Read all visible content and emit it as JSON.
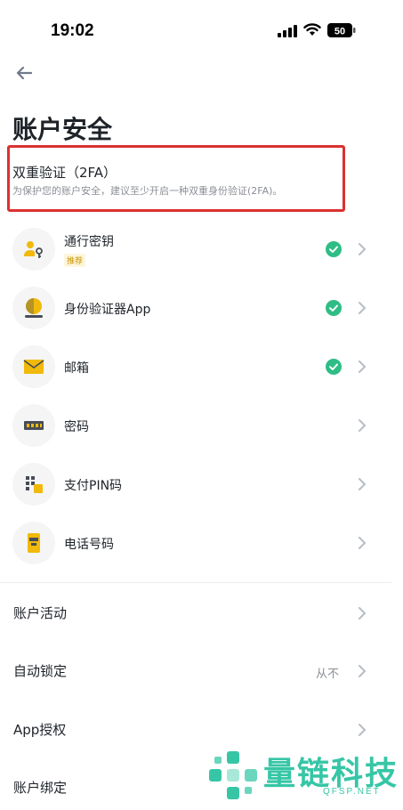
{
  "status_bar": {
    "time": "19:02",
    "battery": "50"
  },
  "page": {
    "title": "账户安全"
  },
  "two_fa": {
    "title": "双重验证（2FA）",
    "description": "为保护您的账户安全，建议至少开启一种双重身份验证(2FA)。"
  },
  "methods": [
    {
      "label": "通行密钥",
      "badge": "推荐",
      "enabled": true,
      "icon": "passkey-icon"
    },
    {
      "label": "身份验证器App",
      "enabled": true,
      "icon": "authenticator-icon"
    },
    {
      "label": "邮箱",
      "enabled": true,
      "icon": "email-icon"
    },
    {
      "label": "密码",
      "enabled": false,
      "icon": "password-icon"
    },
    {
      "label": "支付PIN码",
      "enabled": false,
      "icon": "pin-icon"
    },
    {
      "label": "电话号码",
      "enabled": false,
      "icon": "phone-icon"
    }
  ],
  "settings": [
    {
      "label": "账户活动",
      "value": ""
    },
    {
      "label": "自动锁定",
      "value": "从不"
    },
    {
      "label": "App授权",
      "value": ""
    },
    {
      "label": "账户绑定",
      "value": ""
    }
  ],
  "watermark": {
    "text": "量链科技",
    "sub": "QFSP.NET"
  },
  "colors": {
    "accent": "#F0B90B",
    "check": "#2EBD85",
    "highlight": "#DC3131",
    "watermark": "#36C6A6"
  }
}
